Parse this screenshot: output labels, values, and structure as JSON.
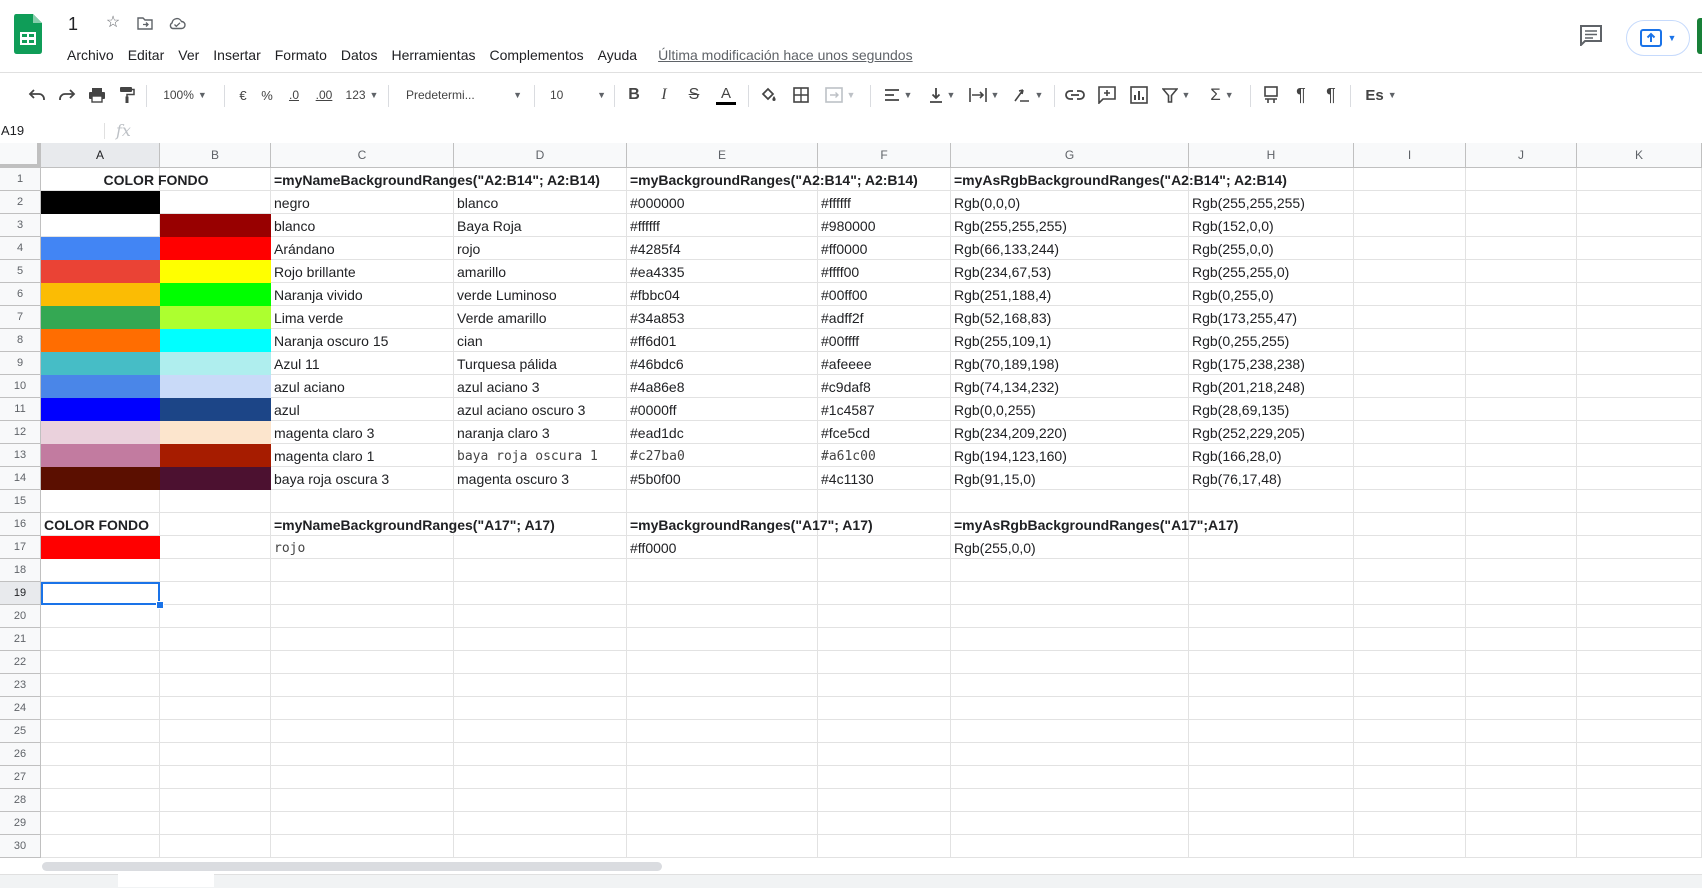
{
  "header": {
    "title": "1",
    "menu": [
      "Archivo",
      "Editar",
      "Ver",
      "Insertar",
      "Formato",
      "Datos",
      "Herramientas",
      "Complementos",
      "Ayuda"
    ],
    "last_edit": "Última modificación hace unos segundos",
    "icons": [
      "star-icon",
      "move-folder-icon",
      "cloud-status-icon",
      "comments-icon",
      "present-icon"
    ]
  },
  "toolbar": {
    "zoom": "100%",
    "currency": "€",
    "percent": "%",
    "dec_decrease": ".0",
    "dec_increase": ".00",
    "more_formats": "123",
    "font": "Predetermi...",
    "font_size": "10",
    "bold": "B",
    "italic": "I",
    "strike": "S",
    "text_color": "A",
    "text_color_value": "#000000",
    "input_tools": "Es"
  },
  "formula_bar": {
    "name_box": "A19",
    "fx": "fx",
    "value": ""
  },
  "grid": {
    "columns": [
      "A",
      "B",
      "C",
      "D",
      "E",
      "F",
      "G",
      "H",
      "I",
      "J",
      "K"
    ],
    "rows": [
      "1",
      "2",
      "3",
      "4",
      "5",
      "6",
      "7",
      "8",
      "9",
      "10",
      "11",
      "12",
      "13",
      "14",
      "15",
      "16",
      "17",
      "18",
      "19",
      "20",
      "21",
      "22",
      "23",
      "24",
      "25",
      "26",
      "27",
      "28",
      "29",
      "30"
    ],
    "selected_cell": "A19",
    "row1": {
      "A": "COLOR FONDO",
      "C": "=myNameBackgroundRanges(\"A2:B14\"; A2:B14)",
      "E": "=myBackgroundRanges(\"A2:B14\"; A2:B14)",
      "G": "=myAsRgbBackgroundRanges(\"A2:B14\"; A2:B14)"
    },
    "data_rows": [
      {
        "a_color": "#000000",
        "b_color": "#ffffff",
        "C": "negro",
        "D": "blanco",
        "E": "#000000",
        "F": "#ffffff",
        "G": "Rgb(0,0,0)",
        "H": "Rgb(255,255,255)"
      },
      {
        "a_color": "#ffffff",
        "b_color": "#980000",
        "C": "blanco",
        "D": "Baya Roja",
        "E": "#ffffff",
        "F": "#980000",
        "G": "Rgb(255,255,255)",
        "H": "Rgb(152,0,0)"
      },
      {
        "a_color": "#4285f4",
        "b_color": "#ff0000",
        "C": "Arándano",
        "D": "rojo",
        "E": "#4285f4",
        "F": "#ff0000",
        "G": "Rgb(66,133,244)",
        "H": "Rgb(255,0,0)"
      },
      {
        "a_color": "#ea4335",
        "b_color": "#ffff00",
        "C": "Rojo brillante",
        "D": "amarillo",
        "E": "#ea4335",
        "F": "#ffff00",
        "G": "Rgb(234,67,53)",
        "H": "Rgb(255,255,0)"
      },
      {
        "a_color": "#fbbc04",
        "b_color": "#00ff00",
        "C": "Naranja vivido",
        "D": "verde Luminoso",
        "E": "#fbbc04",
        "F": "#00ff00",
        "G": "Rgb(251,188,4)",
        "H": "Rgb(0,255,0)"
      },
      {
        "a_color": "#34a853",
        "b_color": "#adff2f",
        "C": "Lima verde",
        "D": "Verde amarillo",
        "E": "#34a853",
        "F": "#adff2f",
        "G": "Rgb(52,168,83)",
        "H": "Rgb(173,255,47)"
      },
      {
        "a_color": "#ff6d01",
        "b_color": "#00ffff",
        "C": "Naranja oscuro 15",
        "D": "cian",
        "E": "#ff6d01",
        "F": "#00ffff",
        "G": "Rgb(255,109,1)",
        "H": "Rgb(0,255,255)"
      },
      {
        "a_color": "#46bdc6",
        "b_color": "#afeeee",
        "C": "Azul 11",
        "D": "Turquesa pálida",
        "E": "#46bdc6",
        "F": "#afeeee",
        "G": "Rgb(70,189,198)",
        "H": "Rgb(175,238,238)"
      },
      {
        "a_color": "#4a86e8",
        "b_color": "#c9daf8",
        "C": "azul aciano",
        "D": "azul aciano 3",
        "E": "#4a86e8",
        "F": "#c9daf8",
        "G": "Rgb(74,134,232)",
        "H": "Rgb(201,218,248)"
      },
      {
        "a_color": "#0000ff",
        "b_color": "#1c4587",
        "C": "azul",
        "D": "azul aciano oscuro 3",
        "E": "#0000ff",
        "F": "#1c4587",
        "G": "Rgb(0,0,255)",
        "H": "Rgb(28,69,135)"
      },
      {
        "a_color": "#ead1dc",
        "b_color": "#fce5cd",
        "C": "magenta claro 3",
        "D": "naranja claro 3",
        "E": "#ead1dc",
        "F": "#fce5cd",
        "G": "Rgb(234,209,220)",
        "H": "Rgb(252,229,205)"
      },
      {
        "a_color": "#c27ba0",
        "b_color": "#a61c00",
        "C": "magenta claro 1",
        "D": "baya roja oscura 1",
        "E": "#c27ba0",
        "F": "#a61c00",
        "G": "Rgb(194,123,160)",
        "H": "Rgb(166,28,0)",
        "mono": true
      },
      {
        "a_color": "#5b0f00",
        "b_color": "#4c1130",
        "C": "baya roja oscura 3",
        "D": "magenta oscuro 3",
        "E": "#5b0f00",
        "F": "#4c1130",
        "G": "Rgb(91,15,0)",
        "H": "Rgb(76,17,48)"
      }
    ],
    "row16": {
      "A": "COLOR FONDO",
      "C": "=myNameBackgroundRanges(\"A17\"; A17)",
      "E": "=myBackgroundRanges(\"A17\"; A17)",
      "G": "=myAsRgbBackgroundRanges(\"A17\";A17)"
    },
    "row17": {
      "a_color": "#ff0000",
      "C": "rojo",
      "E": "#ff0000",
      "G": "Rgb(255,0,0)"
    }
  }
}
